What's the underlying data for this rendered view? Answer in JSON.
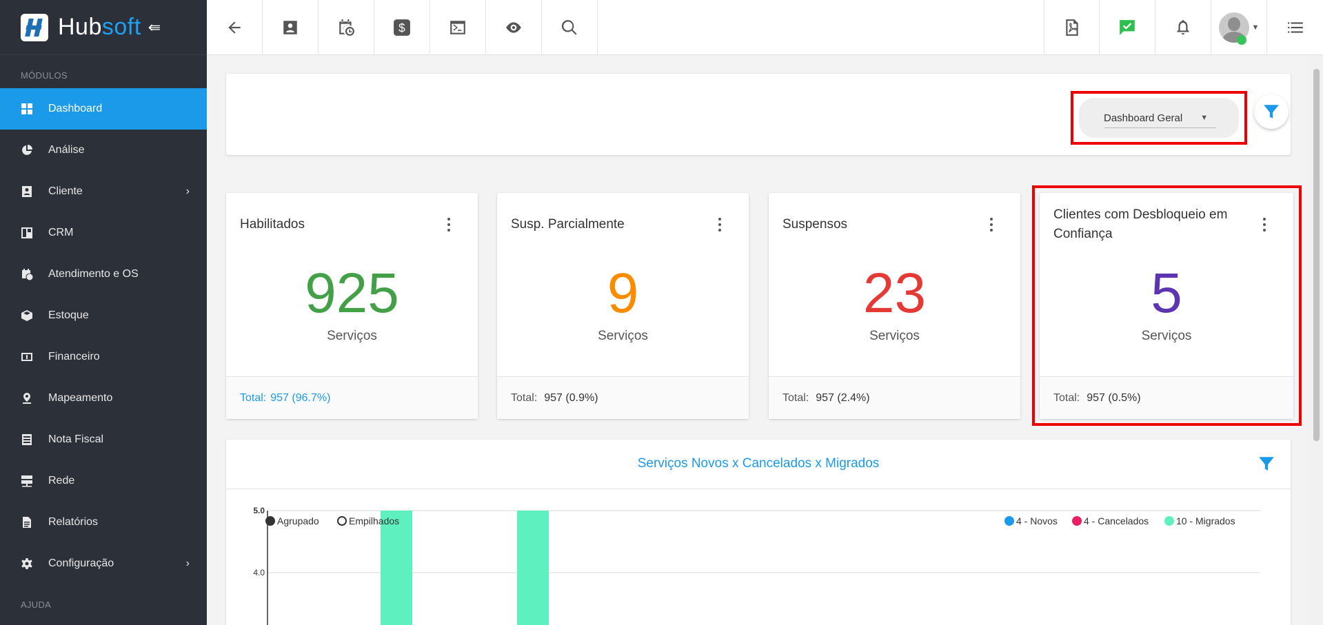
{
  "brand": {
    "name_a": "Hub",
    "name_b": "soft"
  },
  "sidebar": {
    "section_modules": "MÓDULOS",
    "section_help": "AJUDA",
    "items": [
      {
        "label": "Dashboard",
        "icon": "dashboard-icon",
        "active": true
      },
      {
        "label": "Análise",
        "icon": "pie-chart-icon"
      },
      {
        "label": "Cliente",
        "icon": "contact-card-icon",
        "has_submenu": true
      },
      {
        "label": "CRM",
        "icon": "crm-board-icon"
      },
      {
        "label": "Atendimento e OS",
        "icon": "calendar-clock-icon"
      },
      {
        "label": "Estoque",
        "icon": "box-icon"
      },
      {
        "label": "Financeiro",
        "icon": "money-icon"
      },
      {
        "label": "Mapeamento",
        "icon": "map-pin-icon"
      },
      {
        "label": "Nota Fiscal",
        "icon": "receipt-icon"
      },
      {
        "label": "Rede",
        "icon": "server-icon"
      },
      {
        "label": "Relatórios",
        "icon": "document-icon"
      },
      {
        "label": "Configuração",
        "icon": "gear-icon",
        "has_submenu": true
      }
    ]
  },
  "topbar": {
    "left_icons": [
      "back-arrow-icon",
      "contact-card-icon",
      "calendar-clock-icon",
      "dollar-icon",
      "terminal-icon",
      "eye-icon",
      "search-icon"
    ],
    "right_icons": [
      "pdf-icon",
      "checked-message-icon",
      "bell-icon",
      "avatar",
      "list-menu-icon"
    ]
  },
  "filter": {
    "dashboard_select": "Dashboard Geral"
  },
  "stats": [
    {
      "title": "Habilitados",
      "value": "925",
      "unit": "Serviços",
      "total_label": "Total:",
      "total_value": "957 (96.7%)",
      "color": "#43a047"
    },
    {
      "title": "Susp. Parcialmente",
      "value": "9",
      "unit": "Serviços",
      "total_label": "Total:",
      "total_value": "957 (0.9%)",
      "color": "#fb8c00"
    },
    {
      "title": "Suspensos",
      "value": "23",
      "unit": "Serviços",
      "total_label": "Total:",
      "total_value": "957 (2.4%)",
      "color": "#e53935"
    },
    {
      "title": "Clientes com Desbloqueio em Confiança",
      "value": "5",
      "unit": "Serviços",
      "total_label": "Total:",
      "total_value": "957 (0.5%)",
      "color": "#5e35b1"
    }
  ],
  "chart_card": {
    "title": "Serviços Novos x Cancelados x Migrados",
    "mode_options": [
      "Agrupado",
      "Empilhados"
    ],
    "selected_mode": "Agrupado"
  },
  "chart_data": {
    "type": "bar",
    "y_ticks": [
      "5.0",
      "4.0"
    ],
    "ylim": [
      0,
      5
    ],
    "legend_position": "top-right",
    "series": [
      {
        "name": "4 - Novos",
        "color": "#1a9ae8",
        "values": []
      },
      {
        "name": "4 - Cancelados",
        "color": "#e91e63",
        "values": []
      },
      {
        "name": "10 - Migrados",
        "color": "#5ff0c0",
        "values": [
          5,
          5
        ]
      }
    ]
  }
}
